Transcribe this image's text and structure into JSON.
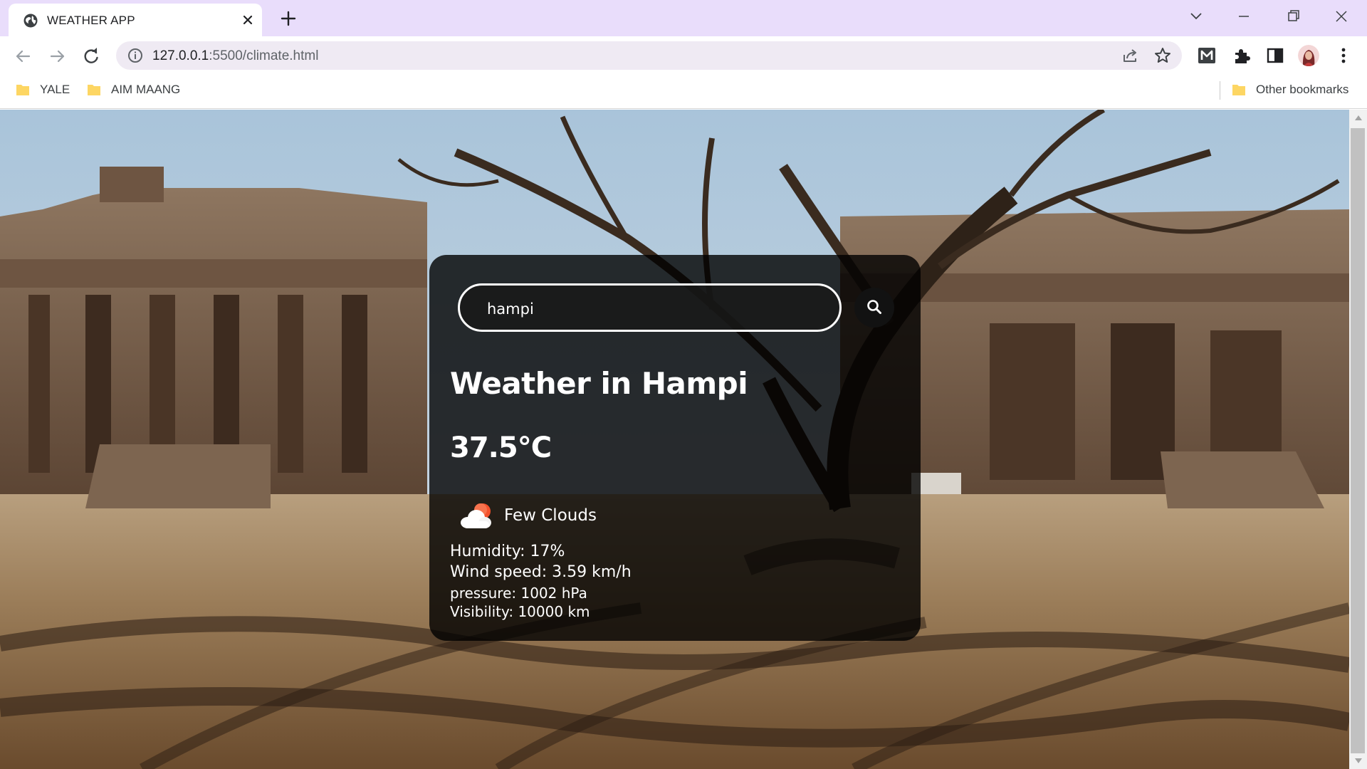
{
  "browser": {
    "tab": {
      "title": "WEATHER APP"
    },
    "address": {
      "host": "127.0.0.1",
      "rest": ":5500/climate.html"
    },
    "bookmarks": [
      {
        "label": "YALE"
      },
      {
        "label": "AIM MAANG"
      }
    ],
    "other_bookmarks": "Other bookmarks"
  },
  "weather": {
    "search": {
      "value": "hampi"
    },
    "city_heading": "Weather in Hampi",
    "temperature": "37.5°C",
    "description": "Few Clouds",
    "icon": "few-clouds-icon",
    "humidity": "Humidity: 17%",
    "wind": "Wind speed: 3.59 km/h",
    "pressure": "pressure: 1002 hPa",
    "visibility": "Visibility: 10000 km"
  },
  "colors": {
    "tab_strip": "#e9ddfb",
    "card_background": "rgba(0,0,0,0.80)",
    "text": "#ffffff"
  }
}
